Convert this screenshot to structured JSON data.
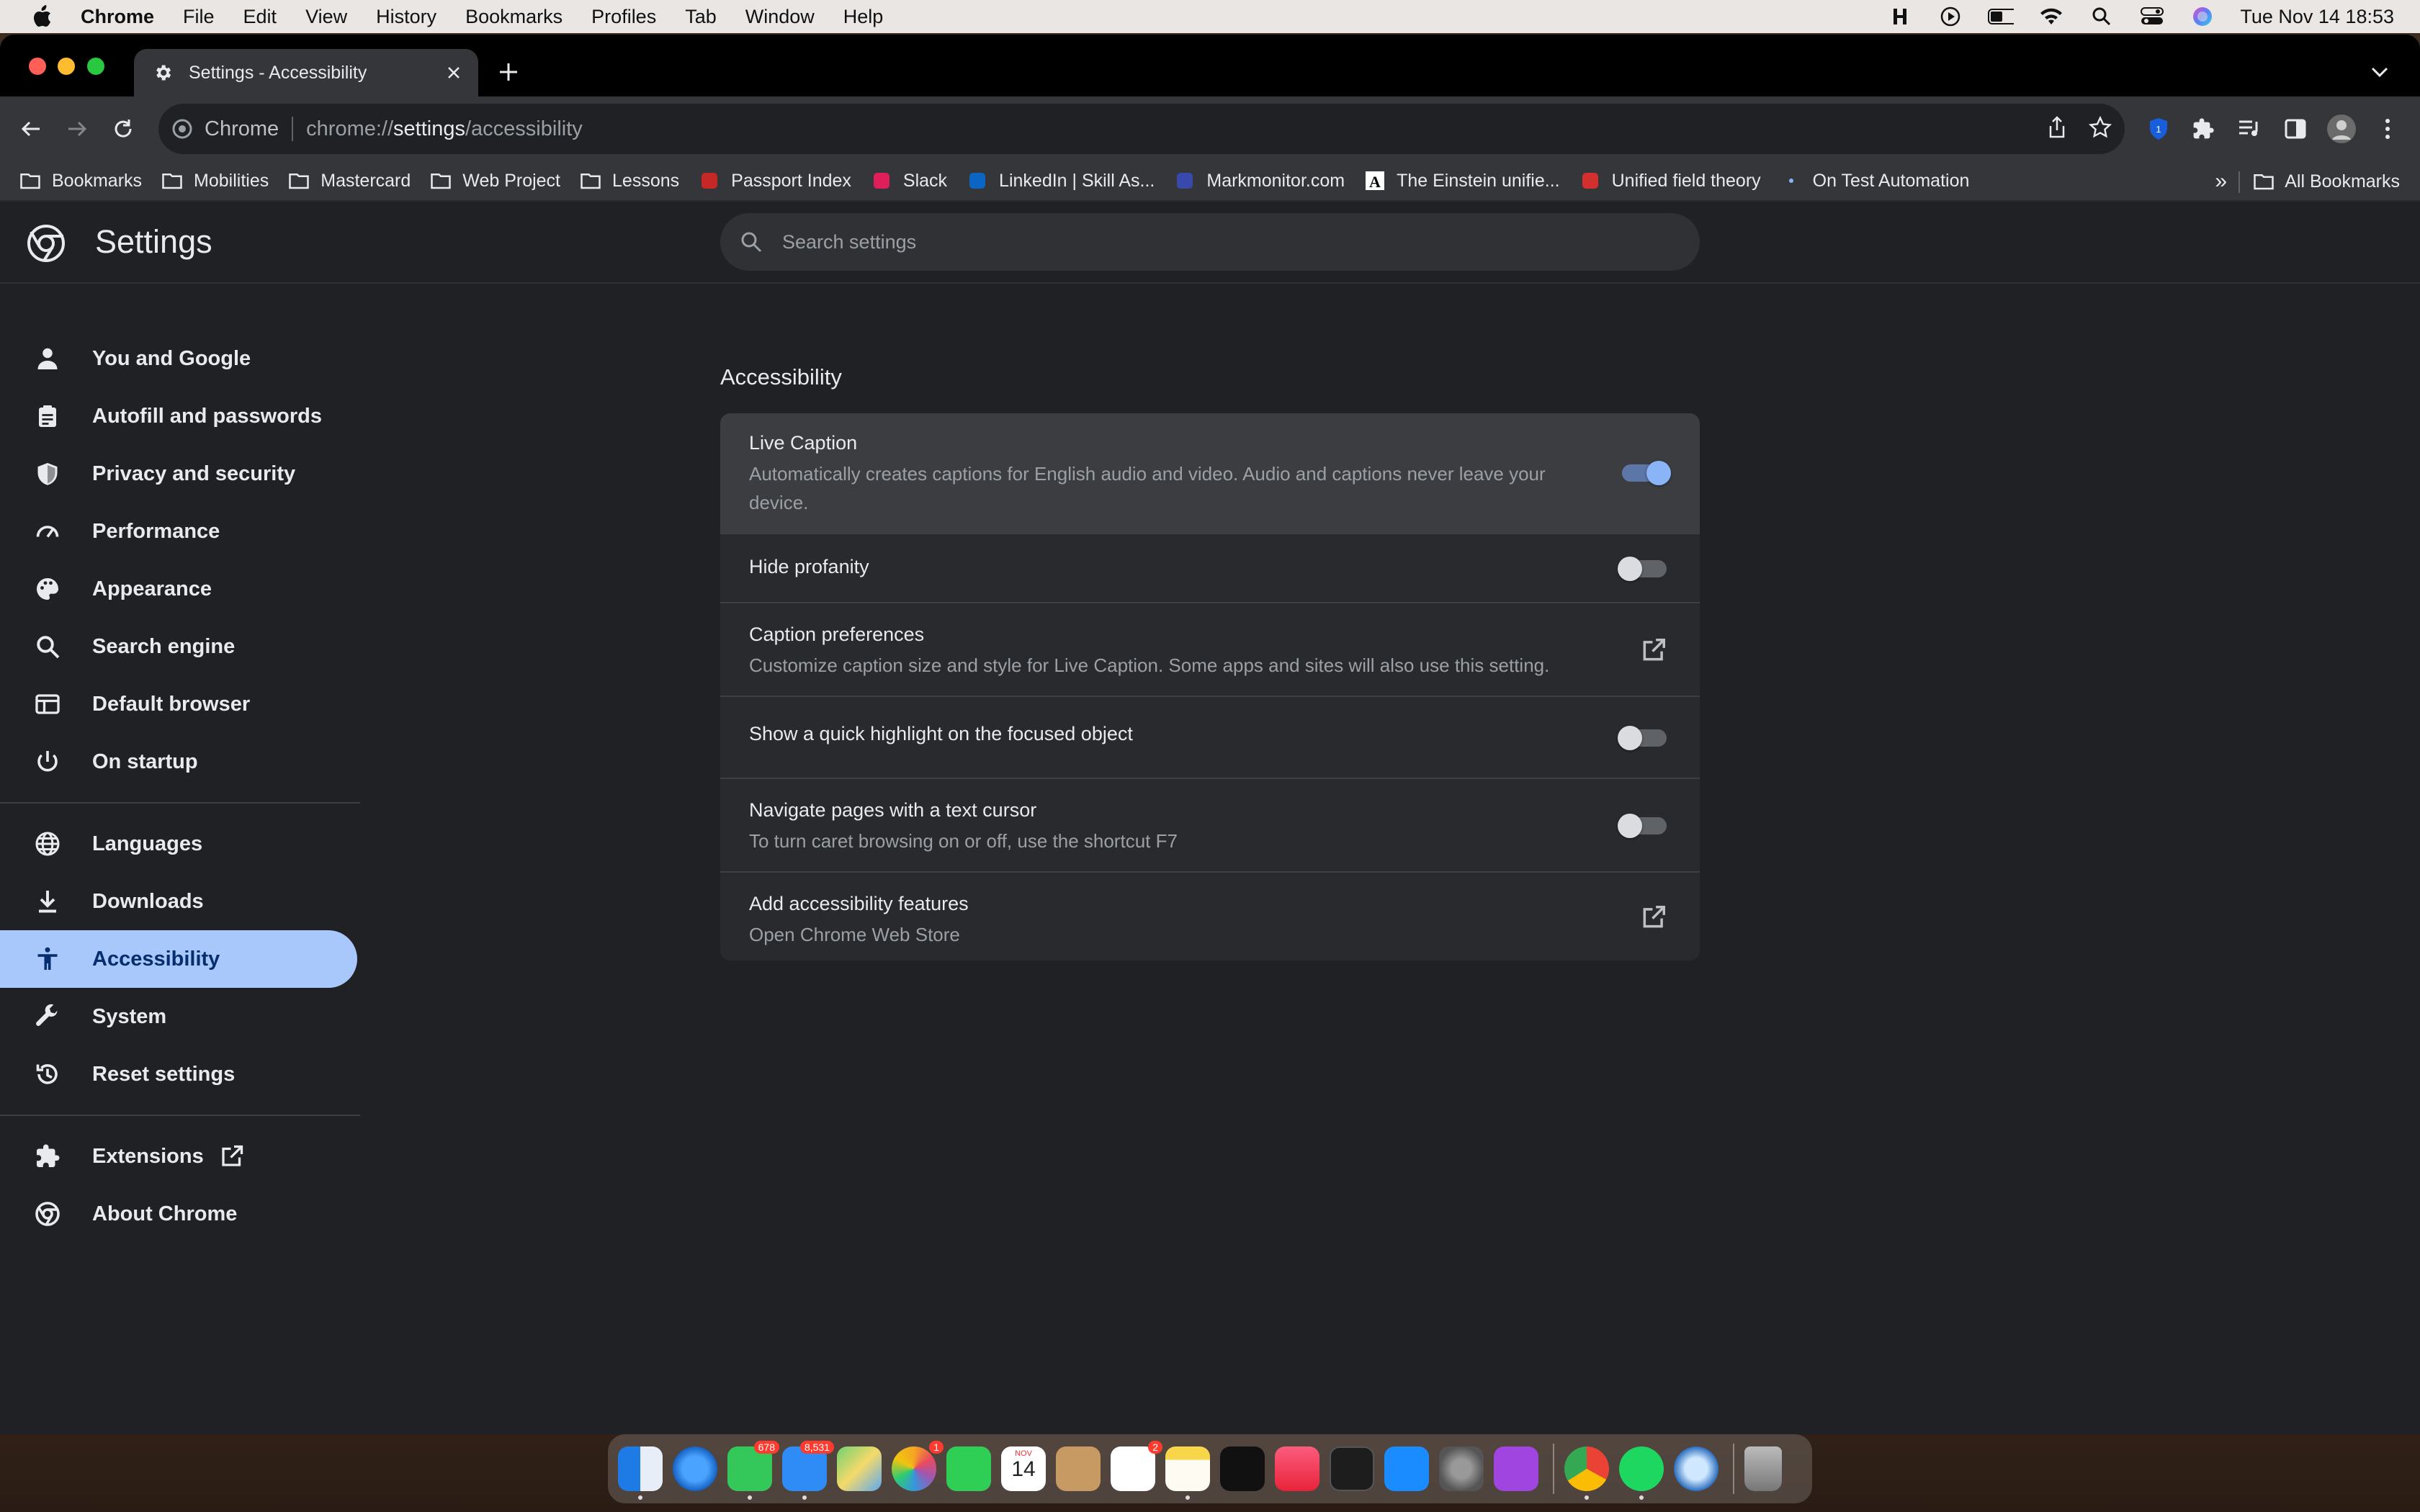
{
  "menubar": {
    "app_name": "Chrome",
    "items": [
      "File",
      "Edit",
      "View",
      "History",
      "Bookmarks",
      "Profiles",
      "Tab",
      "Window",
      "Help"
    ],
    "status_icons": [
      "h-app-icon",
      "play-icon",
      "battery-icon",
      "wifi-icon",
      "spotlight-search-icon",
      "control-center-icon",
      "siri-icon"
    ],
    "clock": "Tue Nov 14  18:53"
  },
  "tab": {
    "title": "Settings - Accessibility",
    "icon": "gear-icon"
  },
  "omnibox": {
    "site_name": "Chrome",
    "url_prefix": "chrome://",
    "url_host": "settings",
    "url_path": "/accessibility"
  },
  "bookmarks": {
    "items": [
      {
        "label": "Bookmarks",
        "icon": "folder-icon"
      },
      {
        "label": "Mobilities",
        "icon": "folder-icon"
      },
      {
        "label": "Mastercard",
        "icon": "folder-icon"
      },
      {
        "label": "Web Project",
        "icon": "folder-icon"
      },
      {
        "label": "Lessons",
        "icon": "folder-icon"
      },
      {
        "label": "Passport Index",
        "icon": "passport-index-icon"
      },
      {
        "label": "Slack",
        "icon": "slack-icon"
      },
      {
        "label": "LinkedIn | Skill As...",
        "icon": "linkedin-icon"
      },
      {
        "label": "Markmonitor.com",
        "icon": "markmonitor-icon"
      },
      {
        "label": "The Einstein unifie...",
        "icon": "letter-a-icon"
      },
      {
        "label": "Unified field theory",
        "icon": "s-logo-icon"
      },
      {
        "label": "On Test Automation",
        "icon": "dot-icon"
      }
    ],
    "more": "»",
    "all": "All Bookmarks"
  },
  "settings": {
    "title": "Settings",
    "search_placeholder": "Search settings"
  },
  "sidebar": {
    "items": [
      {
        "label": "You and Google",
        "icon": "person-icon"
      },
      {
        "label": "Autofill and passwords",
        "icon": "clipboard-icon"
      },
      {
        "label": "Privacy and security",
        "icon": "shield-icon"
      },
      {
        "label": "Performance",
        "icon": "speedometer-icon"
      },
      {
        "label": "Appearance",
        "icon": "palette-icon"
      },
      {
        "label": "Search engine",
        "icon": "search-icon"
      },
      {
        "label": "Default browser",
        "icon": "browser-icon"
      },
      {
        "label": "On startup",
        "icon": "power-icon"
      },
      {
        "label": "Languages",
        "icon": "globe-icon"
      },
      {
        "label": "Downloads",
        "icon": "download-icon"
      },
      {
        "label": "Accessibility",
        "icon": "accessibility-icon",
        "active": true
      },
      {
        "label": "System",
        "icon": "wrench-icon"
      },
      {
        "label": "Reset settings",
        "icon": "history-icon"
      },
      {
        "label": "Extensions",
        "icon": "puzzle-icon"
      },
      {
        "label": "About Chrome",
        "icon": "chrome-icon"
      }
    ]
  },
  "main": {
    "section_title": "Accessibility",
    "rows": [
      {
        "title": "Live Caption",
        "subtitle": "Automatically creates captions for English audio and video. Audio and captions never leave your device.",
        "control": "toggle",
        "checked": true
      },
      {
        "title": "Hide profanity",
        "subtitle": "",
        "control": "toggle",
        "checked": false
      },
      {
        "title": "Caption preferences",
        "subtitle": "Customize caption size and style for Live Caption. Some apps and sites will also use this setting.",
        "control": "external-link"
      },
      {
        "title": "Show a quick highlight on the focused object",
        "subtitle": "",
        "control": "toggle",
        "checked": false
      },
      {
        "title": "Navigate pages with a text cursor",
        "subtitle": "To turn caret browsing on or off, use the shortcut F7",
        "control": "toggle",
        "checked": false
      },
      {
        "title": "Add accessibility features",
        "subtitle": "Open Chrome Web Store",
        "control": "external-link"
      }
    ]
  },
  "dock": {
    "messages_badge": "678",
    "mail_badge": "8,531",
    "photos_badge": "1",
    "reminders_badge": "2",
    "calendar_month": "NOV",
    "calendar_day": "14"
  },
  "colors": {
    "accent": "#a8c7fa",
    "toggle_on": "#8ab4f8",
    "page_bg": "#202124",
    "card_bg": "#292a2d"
  }
}
